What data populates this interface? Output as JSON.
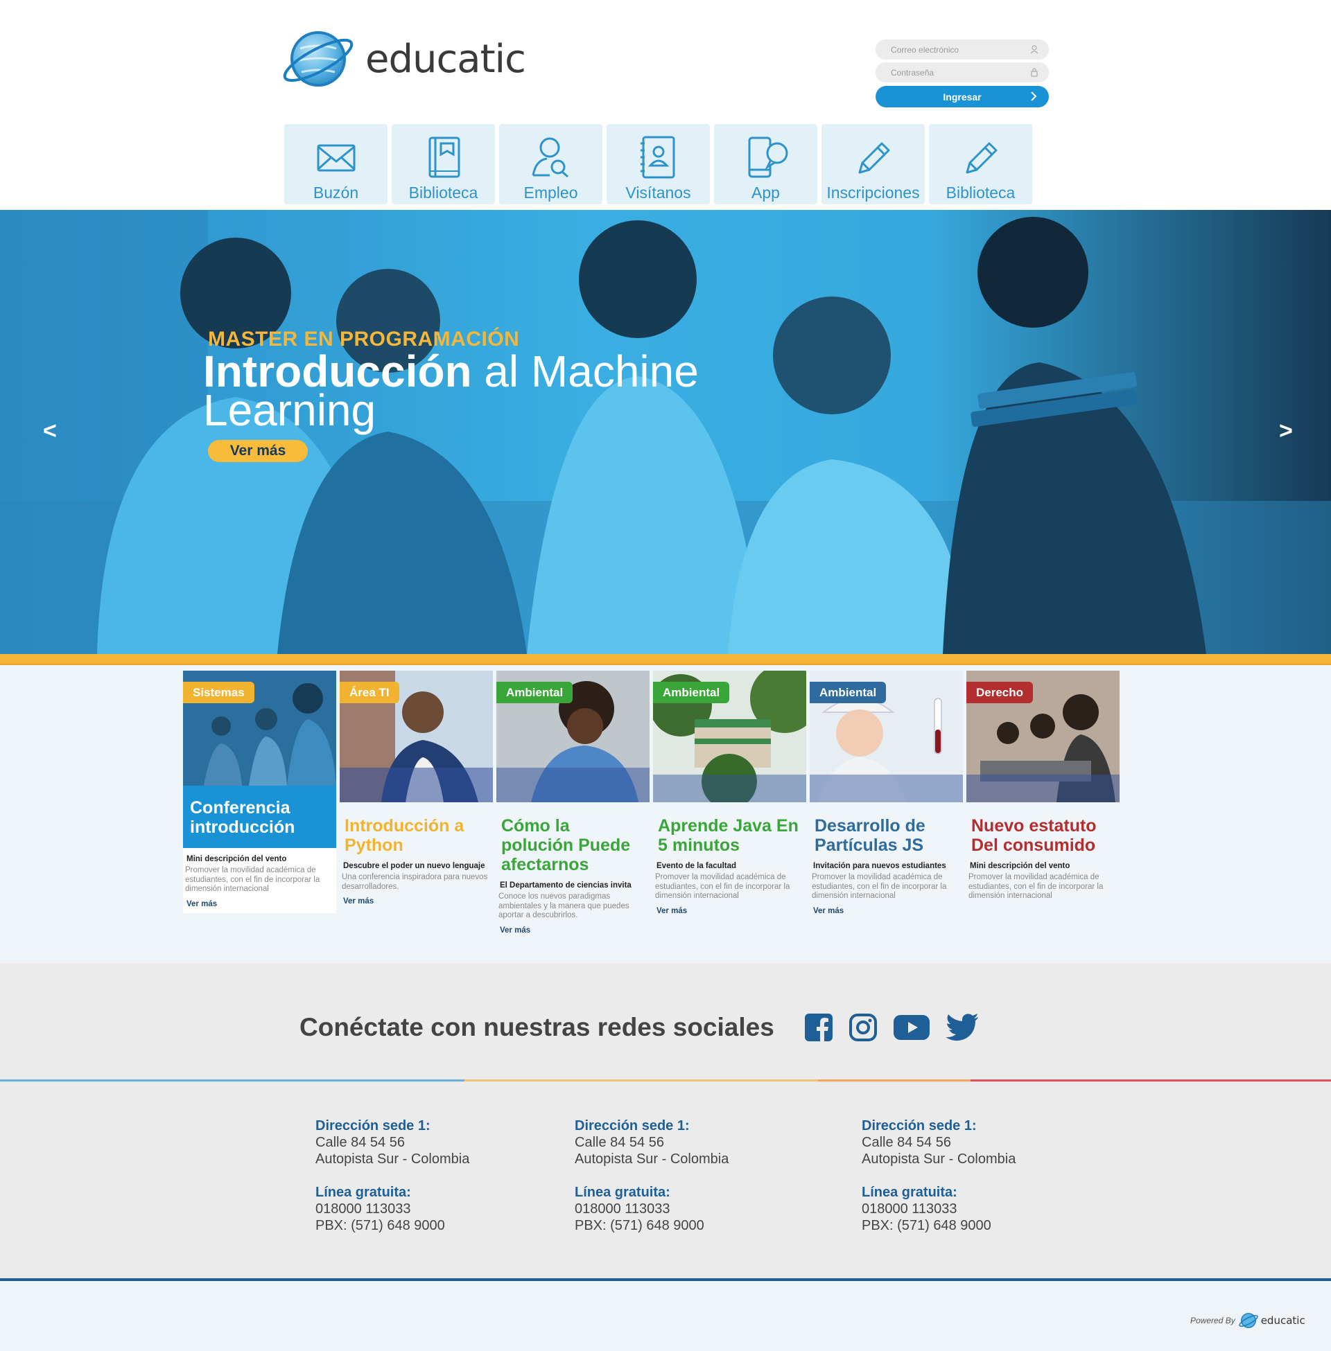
{
  "brand": {
    "name": "educatic",
    "color": "#1a93d6"
  },
  "login": {
    "email_placeholder": "Correo electrónico",
    "password_placeholder": "Contraseña",
    "submit_label": "Ingresar"
  },
  "nav": {
    "items": [
      {
        "label": "Buzón",
        "icon": "envelope-icon"
      },
      {
        "label": "Biblioteca",
        "icon": "book-icon"
      },
      {
        "label": "Empleo",
        "icon": "user-search-icon"
      },
      {
        "label": "Visítanos",
        "icon": "contact-book-icon"
      },
      {
        "label": "App",
        "icon": "phone-chat-icon"
      },
      {
        "label": "Inscripciones",
        "icon": "pencil-icon"
      },
      {
        "label": "Biblioteca",
        "icon": "pencil-icon"
      }
    ]
  },
  "hero": {
    "kicker": "MASTER EN PROGRAMACIÓN",
    "title_bold": "Introducción",
    "title_rest": " al Machine Learning",
    "cta": "Ver más",
    "prev": "<",
    "next": ">"
  },
  "cards": [
    {
      "tag": "Sistemas",
      "tag_color": "#f2b331",
      "title": "Conferencia introducción",
      "title_color": "#ffffff",
      "subtitle": "Mini descripción del vento",
      "description": "Promover la movilidad académica de estudiantes, con el fin de incorporar la dimensión internacional",
      "more": "Ver más"
    },
    {
      "tag": "Área TI",
      "tag_color": "#f2b331",
      "title": "Introducción a Python",
      "title_color": "#f2b331",
      "subtitle": "Descubre el poder un nuevo lenguaje",
      "description": "Una conferencia inspiradora para nuevos desarrolladores.",
      "more": "Ver más"
    },
    {
      "tag": "Ambiental",
      "tag_color": "#3aa63a",
      "title": "Cómo la polución Puede afectarnos",
      "title_color": "#3aa63a",
      "subtitle": "El Departamento de ciencias invita",
      "description": "Conoce los nuevos paradigmas ambientales y la manera que puedes aportar a descubrirlos.",
      "more": "Ver más"
    },
    {
      "tag": "Ambiental",
      "tag_color": "#3aa63a",
      "title": "Aprende Java En 5 minutos",
      "title_color": "#3aa63a",
      "subtitle": "Evento de la facultad",
      "description": "Promover la movilidad académica de estudiantes, con el fin de incorporar la dimensión internacional",
      "more": "Ver más"
    },
    {
      "tag": "Ambiental",
      "tag_color": "#2f6b9c",
      "title": "Desarrollo de Partículas JS",
      "title_color": "#2f6b9c",
      "subtitle": "Invitación para nuevos estudiantes",
      "description": "Promover la movilidad académica de estudiantes, con el fin de incorporar la dimensión internacional",
      "more": "Ver más"
    },
    {
      "tag": "Derecho",
      "tag_color": "#b32e2e",
      "title": "Nuevo estatuto Del consumido",
      "title_color": "#b32e2e",
      "subtitle": "Mini descripción del vento",
      "description": "Promover la movilidad académica de estudiantes, con el fin de incorporar la dimensión internacional",
      "more": ""
    }
  ],
  "social": {
    "title": "Conéctate con nuestras redes sociales",
    "icons": [
      "facebook-icon",
      "instagram-icon",
      "youtube-icon",
      "twitter-icon"
    ],
    "color": "#1d5f96"
  },
  "footer": {
    "columns": [
      {
        "address_heading": "Dirección sede 1:",
        "address_line1": "Calle 84 54 56",
        "address_line2": "Autopista Sur - Colombia",
        "phone_heading": "Línea gratuita:",
        "phone": "018000 113033",
        "pbx": "PBX: (571) 648 9000"
      },
      {
        "address_heading": "Dirección sede 1:",
        "address_line1": "Calle 84 54 56",
        "address_line2": "Autopista Sur - Colombia",
        "phone_heading": "Línea gratuita:",
        "phone": "018000 113033",
        "pbx": "PBX: (571) 648 9000"
      },
      {
        "address_heading": "Dirección sede 1:",
        "address_line1": "Calle 84 54 56",
        "address_line2": "Autopista Sur - Colombia",
        "phone_heading": "Línea gratuita:",
        "phone": "018000 113033",
        "pbx": "PBX: (571) 648 9000"
      }
    ],
    "powered_by": "Powered By",
    "powered_brand": "educatic"
  }
}
